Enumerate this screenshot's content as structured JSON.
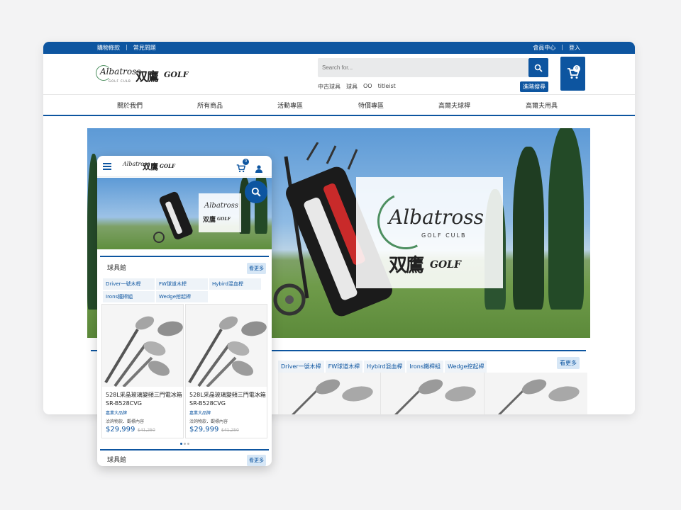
{
  "topbar": {
    "left": [
      "購物條款",
      "常見問題"
    ],
    "right": [
      "會員中心",
      "登入"
    ]
  },
  "logo": {
    "script": "Albatross",
    "sub": "GOLF CULB",
    "cn": "双鷹",
    "golf": "GOLF"
  },
  "search": {
    "placeholder": "Search for...",
    "hot_tags": [
      "中古球具",
      "球具",
      "OO",
      "titleist"
    ],
    "advanced": "進階搜尋"
  },
  "cart": {
    "count": "0"
  },
  "nav": [
    "關於我們",
    "所有商品",
    "活動專區",
    "特價專區",
    "高爾夫球桿",
    "高爾夫用具"
  ],
  "category": {
    "title": "球具館",
    "more": "看更多",
    "tabs": [
      "Driver一號木桿",
      "FW球道木桿",
      "Hybird混血桿",
      "Irons鐵桿組",
      "Wedge挖起桿"
    ]
  },
  "products": [
    {
      "name": "528L采晶玻璃變頻三門電冰箱SR-B528CVG",
      "brand": "嘉業大品牌",
      "note": "洽詢物款．觀標內容",
      "price": "$29,999",
      "old_price": "$41,250"
    },
    {
      "name": "528L采晶玻璃變頻三門電冰箱SR-B528CVG",
      "brand": "嘉業大品牌",
      "note": "洽詢物款．觀標內容",
      "price": "$29,999",
      "old_price": "$41,250"
    }
  ],
  "mobile": {
    "section2_title": "球具館",
    "section2_more": "看更多"
  },
  "colors": {
    "brand_blue": "#0d55a0"
  }
}
